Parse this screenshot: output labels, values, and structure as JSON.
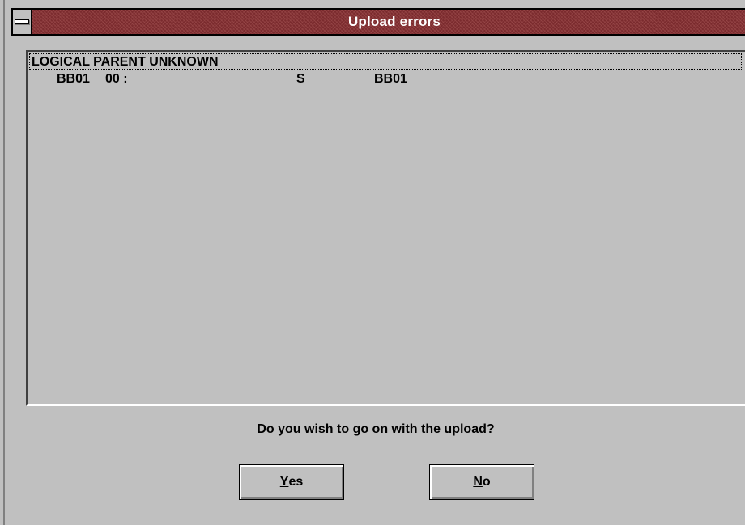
{
  "window": {
    "title": "Upload errors"
  },
  "errors": {
    "header": "LOGICAL PARENT UNKNOWN",
    "rows": [
      {
        "segment": "BB01",
        "code": "00 :",
        "type": "S",
        "parent": "BB01"
      }
    ]
  },
  "prompt": "Do you wish to go on with the upload?",
  "buttons": {
    "yes": {
      "mnemonic": "Y",
      "rest": "es"
    },
    "no": {
      "mnemonic": "N",
      "rest": "o"
    }
  },
  "colors": {
    "titlebar": "#7b2b2e",
    "face": "#c0c0c0",
    "title_text": "#ffffff"
  }
}
